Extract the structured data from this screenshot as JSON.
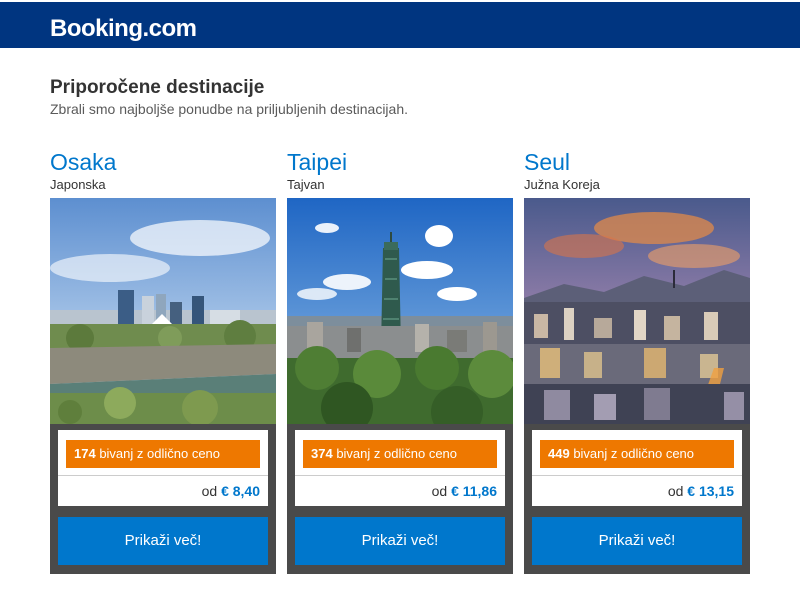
{
  "brand": {
    "logo_text": "Booking",
    "logo_suffix": ".com"
  },
  "section": {
    "title": "Priporočene destinacije",
    "subtitle": "Zbrali smo najboljše ponudbe na priljubljenih destinacijah."
  },
  "destinations": [
    {
      "city": "Osaka",
      "country": "Japonska",
      "count": "174",
      "count_text": " bivanj z odlično ceno",
      "price_prefix": "od ",
      "price": "€ 8,40",
      "button": "Prikaži več!"
    },
    {
      "city": "Taipei",
      "country": "Tajvan",
      "count": "374",
      "count_text": " bivanj z odlično ceno",
      "price_prefix": "od ",
      "price": "€ 11,86",
      "button": "Prikaži več!"
    },
    {
      "city": "Seul",
      "country": "Južna Koreja",
      "count": "449",
      "count_text": " bivanj z odlično ceno",
      "price_prefix": "od ",
      "price": "€ 13,15",
      "button": "Prikaži več!"
    }
  ],
  "colors": {
    "header": "#003580",
    "accent_blue": "#0077cc",
    "badge_orange": "#ee7800",
    "panel_gray": "#4a4a4a"
  }
}
